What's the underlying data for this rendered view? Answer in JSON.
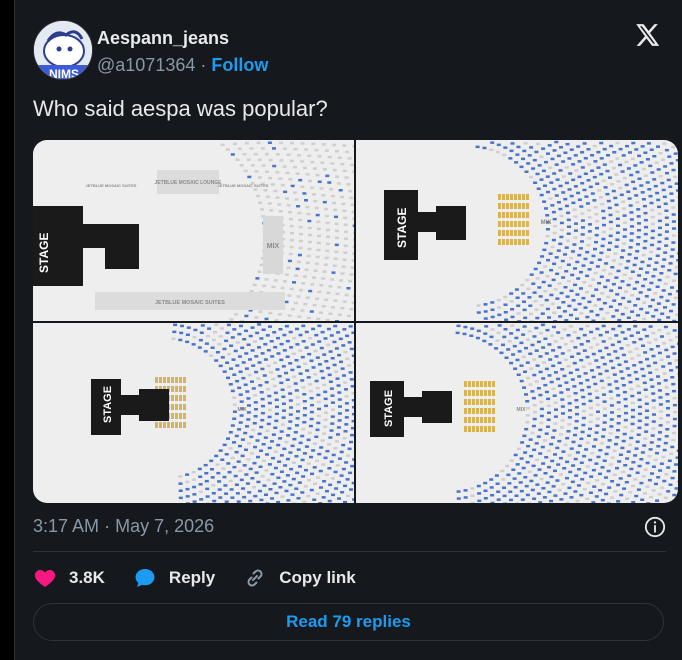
{
  "author": {
    "display_name": "Aespann_jeans",
    "handle": "@a1071364",
    "separator": "·",
    "follow_label": "Follow",
    "avatar_caption": "NIMS"
  },
  "tweet": {
    "text": "Who said aespa was popular?"
  },
  "media": {
    "maps": [
      {
        "stage": "STAGE",
        "mix": "MIX",
        "suite_top": "JETBLUE MOSAIC LOUNGE",
        "suite_left": "JETBLUE MOSAIC SUITES",
        "suite_right": "JETBLUE MOSAIC SUITES",
        "suite_bottom": "JETBLUE MOSAIC SUITES"
      },
      {
        "stage": "STAGE",
        "mix": "MIX"
      },
      {
        "stage": "STAGE",
        "mix": "MIX"
      },
      {
        "stage": "STAGE",
        "mix": "MIX"
      }
    ]
  },
  "meta": {
    "time": "3:17 AM",
    "separator": "·",
    "date": "May 7, 2026"
  },
  "actions": {
    "likes": "3.8K",
    "reply_label": "Reply",
    "copy_link_label": "Copy link"
  },
  "read_replies_label": "Read 79 replies",
  "colors": {
    "accent": "#1d9bf0",
    "like": "#f91880",
    "available_seat": "#4a74c9",
    "premium_seat": "#d9b35a"
  }
}
